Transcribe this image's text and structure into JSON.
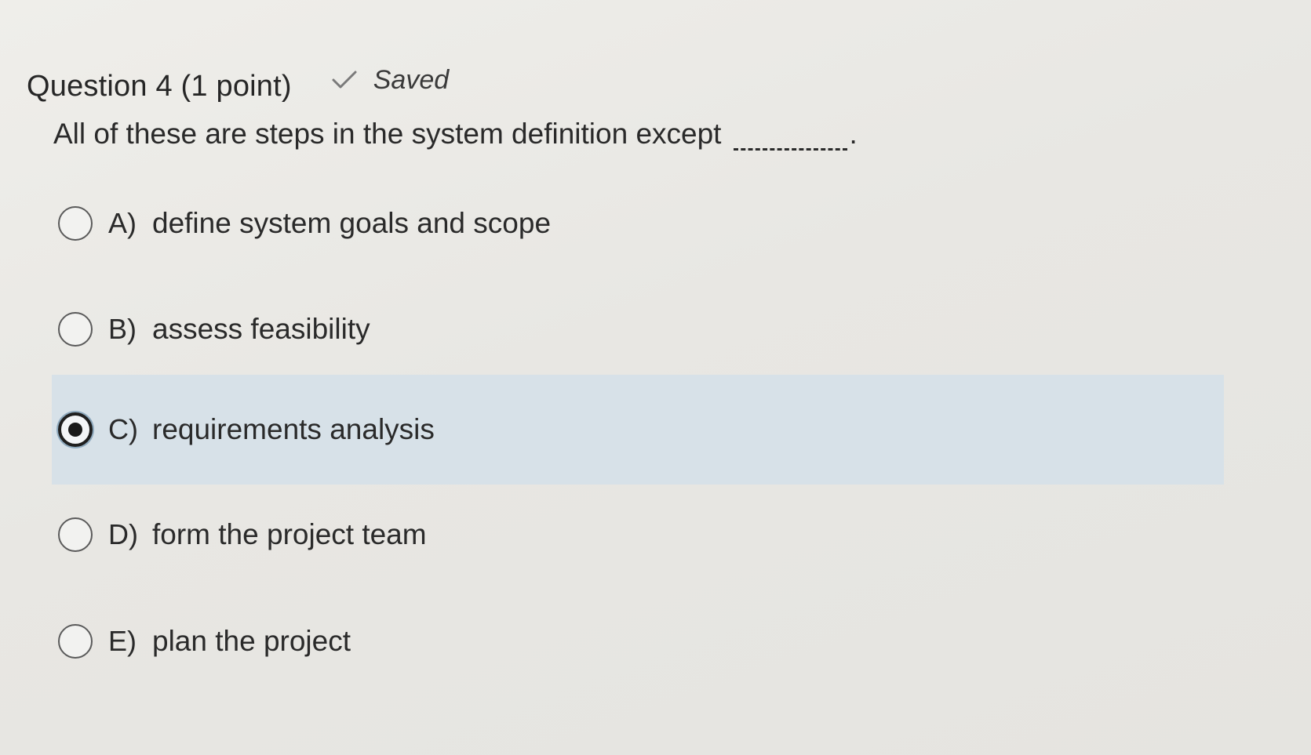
{
  "question": {
    "title": "Question 4 (1 point)",
    "status_icon": "check-icon",
    "status_text": "Saved",
    "prompt": "All of these are steps in the system definition except",
    "blank_suffix": "."
  },
  "options": [
    {
      "letter": "A)",
      "text": "define system goals and scope",
      "selected": false
    },
    {
      "letter": "B)",
      "text": "assess feasibility",
      "selected": false
    },
    {
      "letter": "C)",
      "text": "requirements analysis",
      "selected": true
    },
    {
      "letter": "D)",
      "text": "form the project team",
      "selected": false
    },
    {
      "letter": "E)",
      "text": "plan the project",
      "selected": false
    }
  ],
  "colors": {
    "background": "#e9e8e4",
    "selected_highlight": "#d7e1e8",
    "text": "#2a2a2a"
  }
}
